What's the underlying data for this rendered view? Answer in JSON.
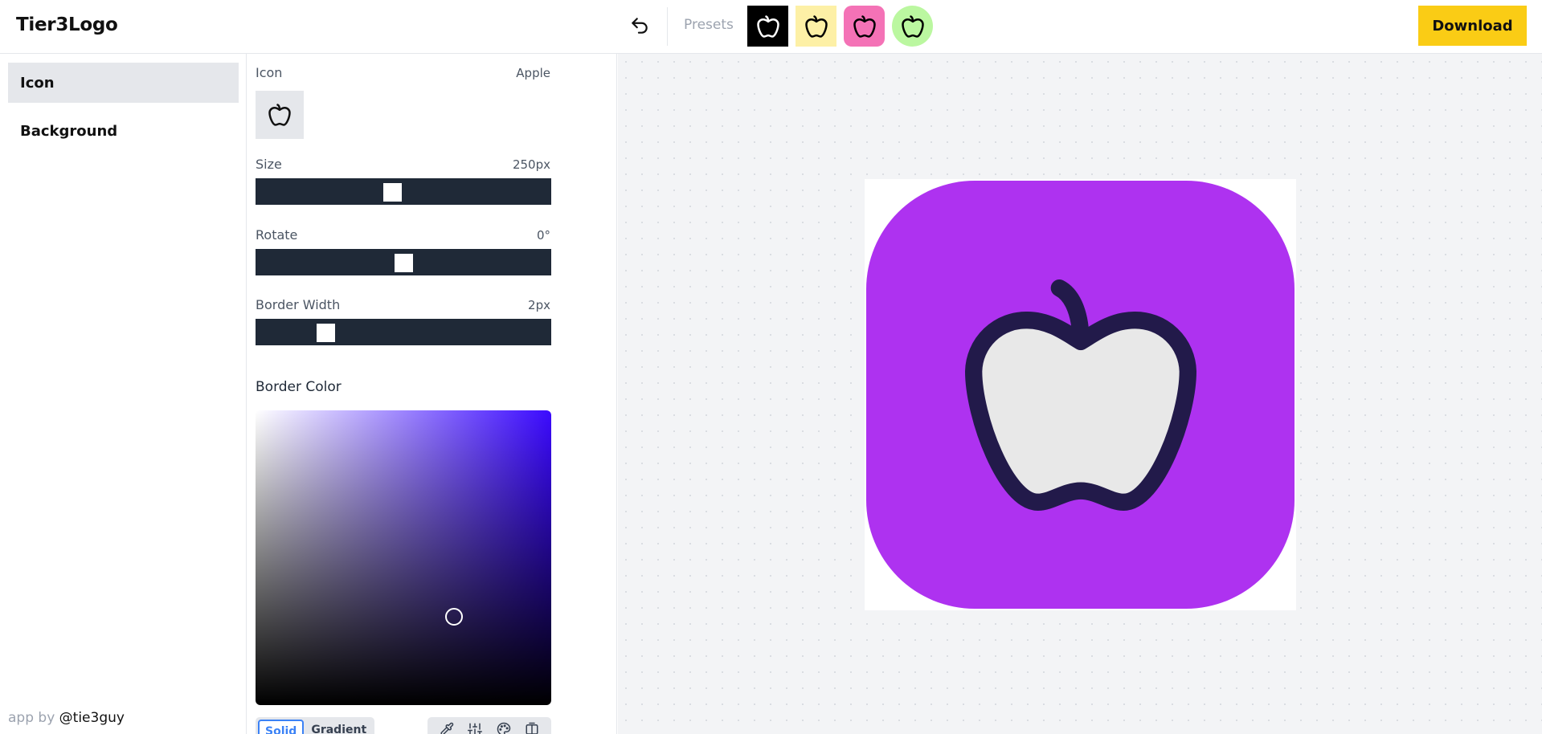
{
  "header": {
    "logo": "Tier3Logo",
    "presets_label": "Presets",
    "download_label": "Download",
    "presets": [
      {
        "bg": "#000000",
        "stroke": "#ffffff",
        "shape": "square"
      },
      {
        "bg": "#fdf0a6",
        "stroke": "#000000",
        "shape": "square"
      },
      {
        "bg": "#f472b6",
        "stroke": "#000000",
        "shape": "rounded"
      },
      {
        "bg": "#bbf7a0",
        "stroke": "#000000",
        "shape": "circle"
      }
    ]
  },
  "sidebar": {
    "items": [
      {
        "label": "Icon",
        "active": true
      },
      {
        "label": "Background",
        "active": false
      }
    ],
    "credit_prefix": "app by",
    "credit_handle": "@tie3guy"
  },
  "panel": {
    "icon_label": "Icon",
    "icon_value": "Apple",
    "size": {
      "label": "Size",
      "value": "250px",
      "position": 0.46
    },
    "rotate": {
      "label": "Rotate",
      "value": "0°",
      "position": 0.5
    },
    "border_width": {
      "label": "Border Width",
      "value": "2px",
      "position": 0.22
    },
    "border_color_label": "Border Color",
    "picker": {
      "hue_color": "#3b0aff",
      "saturation": 0.67,
      "value": 0.3
    },
    "tabs": [
      "Solid",
      "Gradient"
    ],
    "active_tab": "Solid",
    "tools": [
      "eyedropper-icon",
      "sliders-icon",
      "palette-icon",
      "columns-icon"
    ]
  },
  "preview": {
    "background_color": "#ae32f0",
    "border_color": "#221a4a",
    "icon_fill": "#e8e8e8",
    "icon": "apple-icon"
  }
}
